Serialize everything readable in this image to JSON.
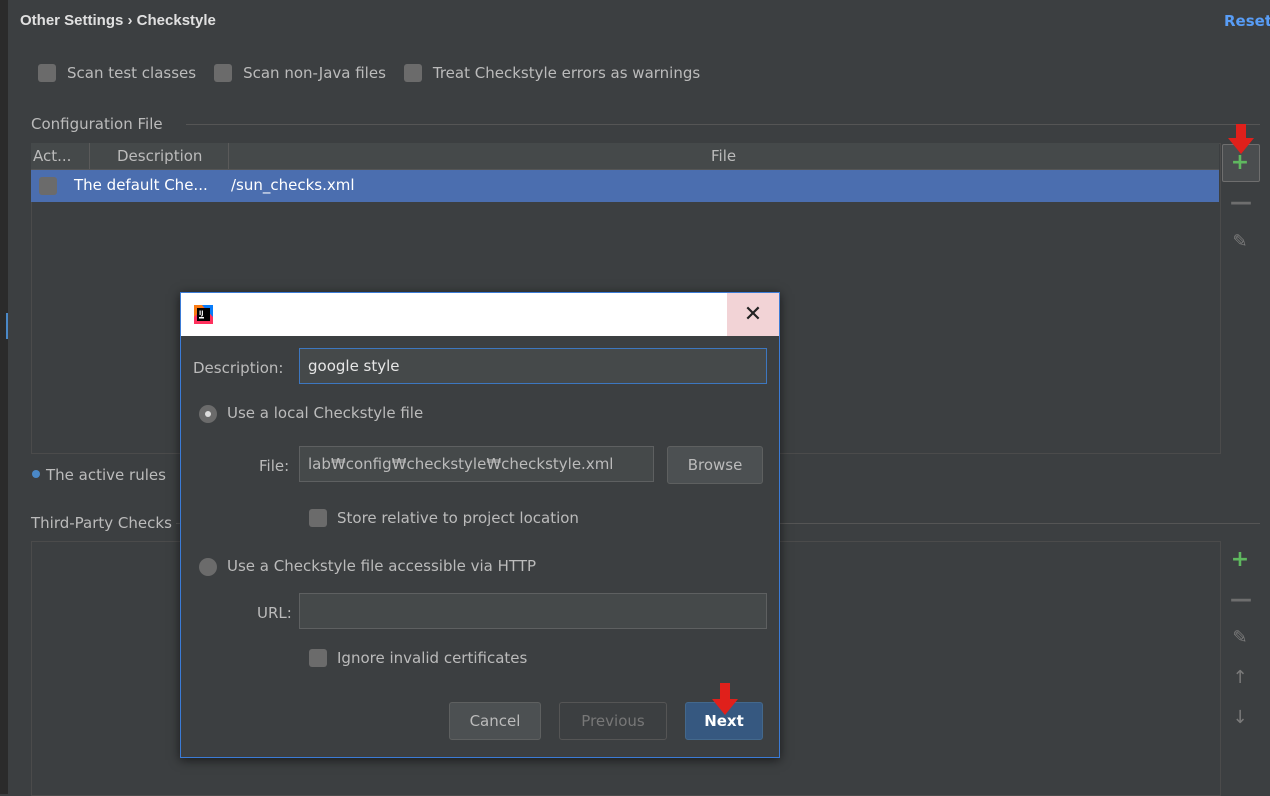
{
  "header": {
    "title": "Other Settings › Checkstyle",
    "reset_label": "Reset"
  },
  "options": {
    "scan_test": "Scan test classes",
    "scan_non_java": "Scan non-Java files",
    "treat_errors": "Treat Checkstyle errors as warnings"
  },
  "config_section": {
    "label": "Configuration File",
    "columns": [
      "Act...",
      "Description",
      "File"
    ],
    "rows": [
      {
        "description": "The default Che...",
        "file": "/sun_checks.xml"
      }
    ]
  },
  "info_text": "The active rules",
  "third_party_label": "Third-Party Checks",
  "dialog": {
    "description_label": "Description:",
    "description_value": "google style",
    "local_option": "Use a local Checkstyle file",
    "file_label": "File:",
    "file_value": "lab₩config₩checkstyle₩checkstyle.xml",
    "browse_label": "Browse",
    "store_relative": "Store relative to project location",
    "http_option": "Use a Checkstyle file accessible via HTTP",
    "url_label": "URL:",
    "url_value": "",
    "ignore_certs": "Ignore invalid certificates",
    "cancel_label": "Cancel",
    "previous_label": "Previous",
    "next_label": "Next",
    "close_glyph": "✕"
  },
  "colors": {
    "background": "#3c3f41",
    "selection": "#4b6eaf",
    "accent_blue": "#589df6",
    "add_green": "#5fb85f",
    "annotation_red": "#e0201b"
  },
  "icons": {
    "add": "+",
    "remove": "—",
    "edit": "✎",
    "move_up": "↑",
    "move_down": "↓"
  }
}
